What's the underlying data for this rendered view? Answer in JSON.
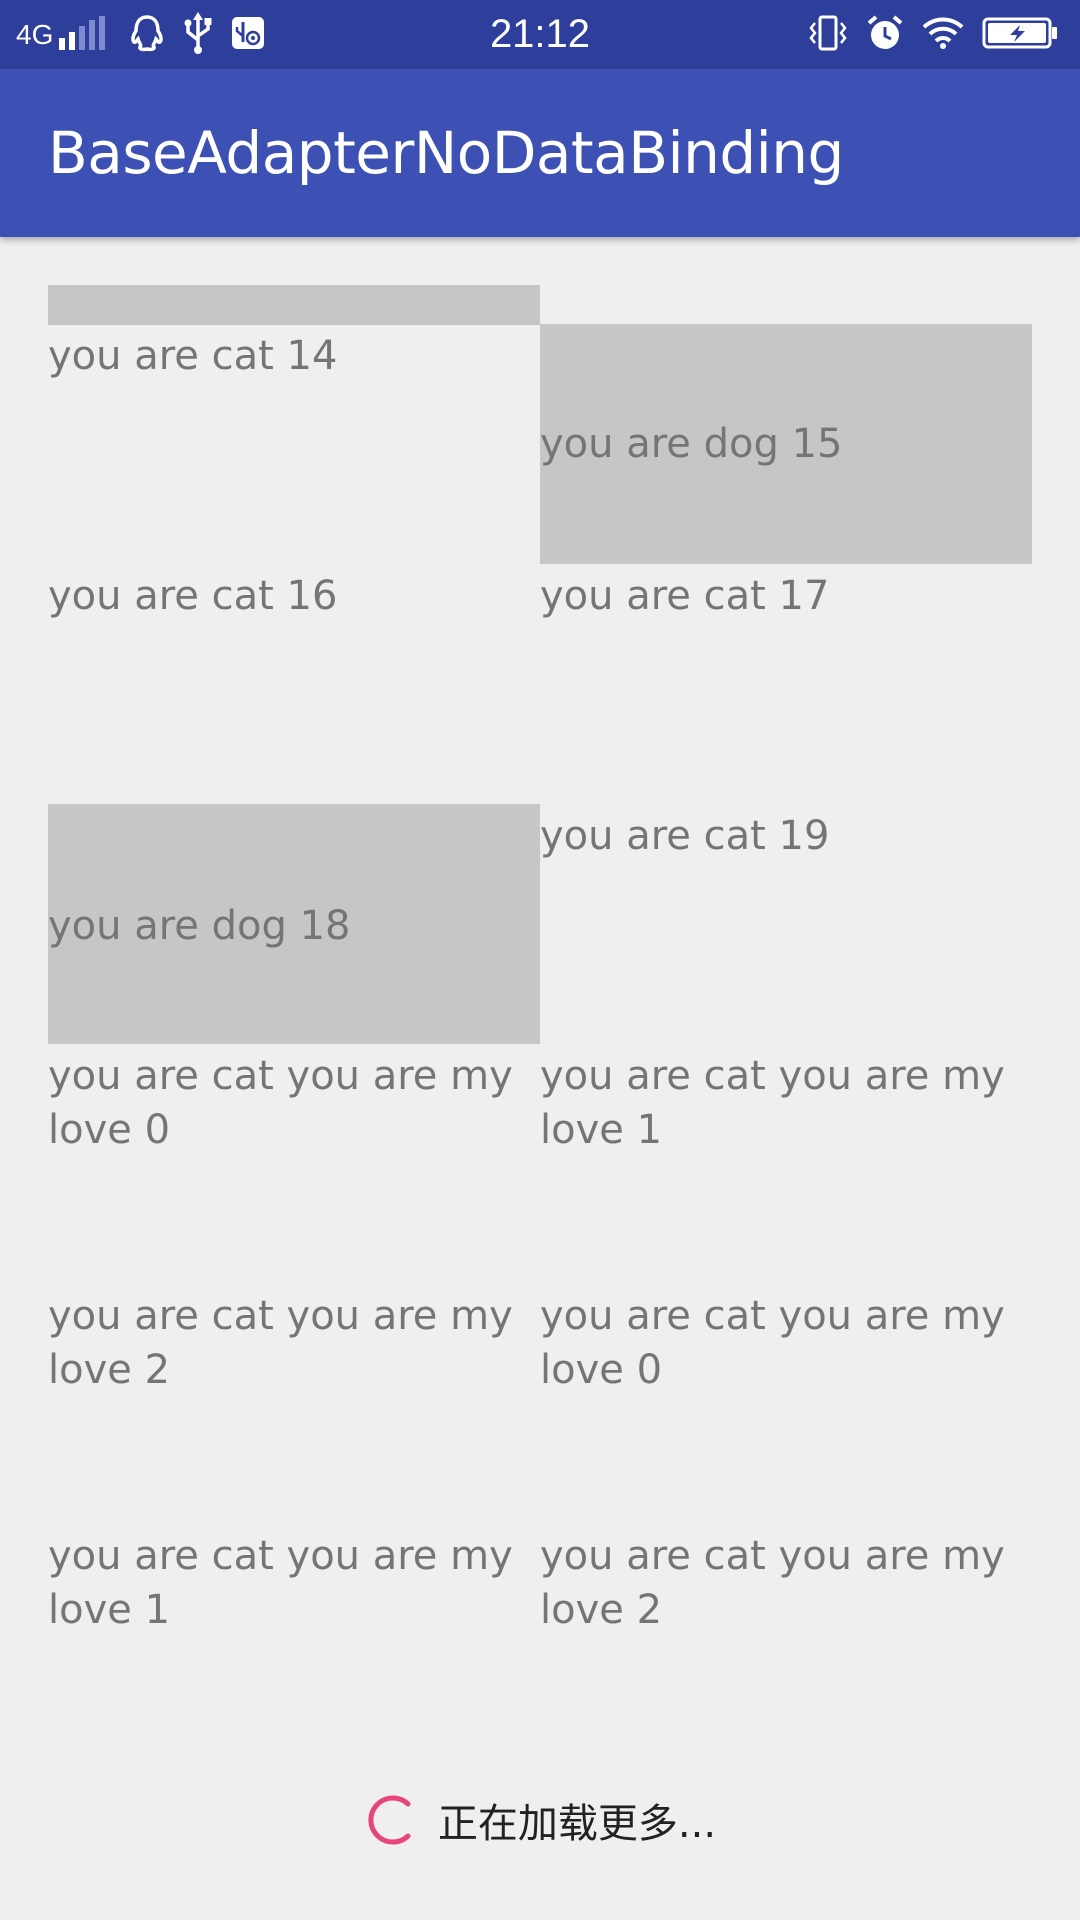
{
  "status_bar": {
    "network": "4G",
    "time": "21:12",
    "icons_left": [
      "signal-icon",
      "qq-icon",
      "usb-icon",
      "usb-debug-icon"
    ],
    "icons_right": [
      "vibrate-icon",
      "alarm-icon",
      "wifi-icon",
      "battery-charging-icon"
    ]
  },
  "app_bar": {
    "title": "BaseAdapterNoDataBinding"
  },
  "grid": {
    "items": [
      {
        "text": "you are cat 14",
        "type": "cat"
      },
      {
        "text": "you are dog 15",
        "type": "dog"
      },
      {
        "text": "you are cat 16",
        "type": "cat"
      },
      {
        "text": "you are cat 17",
        "type": "cat"
      },
      {
        "text": "you are dog 18",
        "type": "dog"
      },
      {
        "text": "you are cat 19",
        "type": "cat"
      },
      {
        "text": "you are cat you are my love 0",
        "type": "cat"
      },
      {
        "text": "you are cat you are my love 1",
        "type": "cat"
      },
      {
        "text": "you are cat you are my love 2",
        "type": "cat"
      },
      {
        "text": "you are cat you are my love 0",
        "type": "cat"
      },
      {
        "text": "you are cat you are my love 1",
        "type": "cat"
      },
      {
        "text": "you are cat you are my love 2",
        "type": "cat"
      }
    ]
  },
  "loading": {
    "text": "正在加载更多..."
  },
  "colors": {
    "status_bar": "#2e3f9b",
    "app_bar": "#3d51b5",
    "background": "#efefef",
    "dog_card": "#c6c6c6",
    "item_text": "#757575",
    "spinner": "#e8457a"
  }
}
